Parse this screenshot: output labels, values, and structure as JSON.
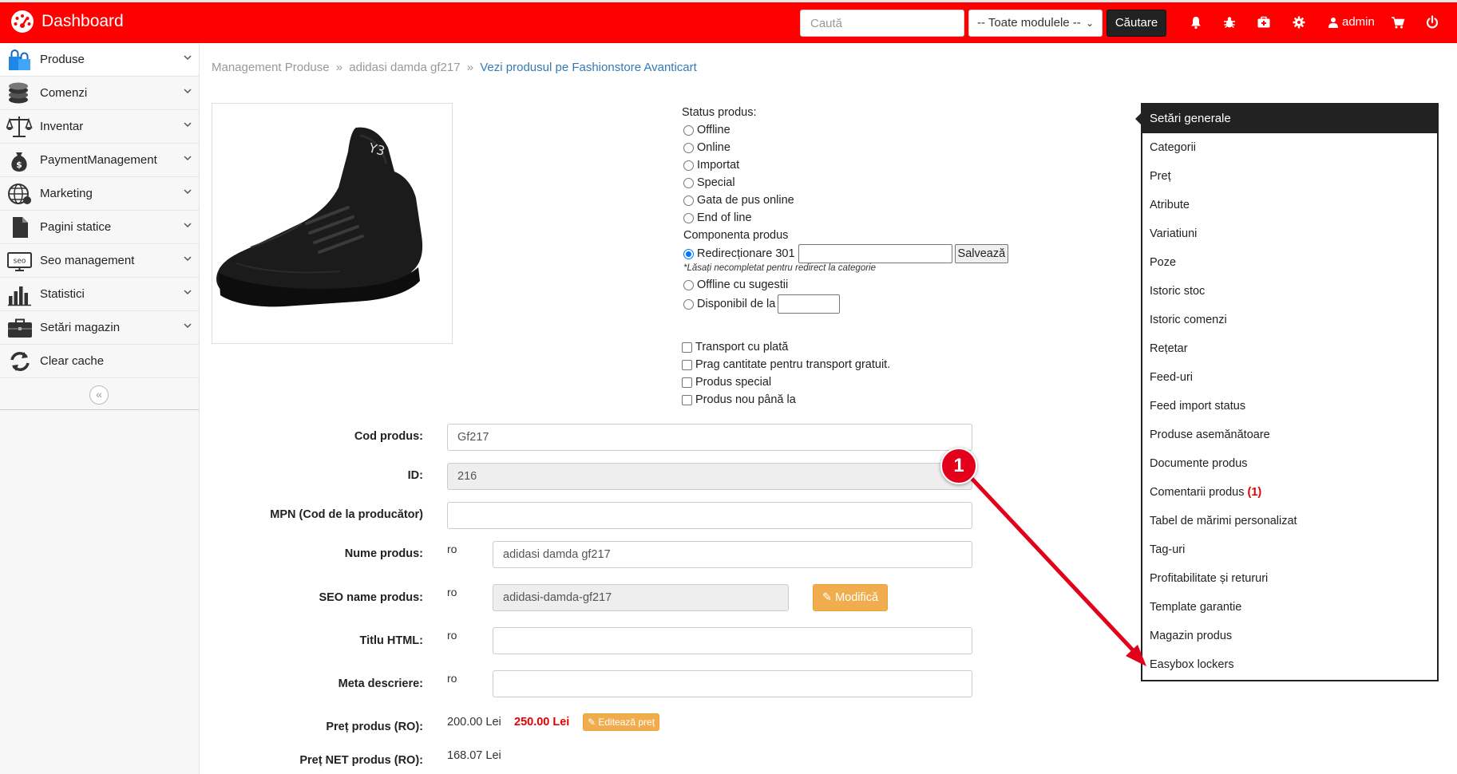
{
  "header": {
    "brand": "Dashboard",
    "search_placeholder": "Caută",
    "module_select": "-- Toate modulele --",
    "search_button": "Căutare",
    "user": "admin",
    "accent": "#ff0000"
  },
  "sidebar": {
    "items": [
      {
        "label": "Produse",
        "icon": "shopping-bags-icon"
      },
      {
        "label": "Comenzi",
        "icon": "coins-icon"
      },
      {
        "label": "Inventar",
        "icon": "scales-icon"
      },
      {
        "label": "PaymentManagement",
        "icon": "money-bag-icon"
      },
      {
        "label": "Marketing",
        "icon": "globe-icon"
      },
      {
        "label": "Pagini statice",
        "icon": "document-icon"
      },
      {
        "label": "Seo management",
        "icon": "seo-icon"
      },
      {
        "label": "Statistici",
        "icon": "bar-chart-icon"
      },
      {
        "label": "Setări magazin",
        "icon": "briefcase-icon"
      },
      {
        "label": "Clear cache",
        "icon": "refresh-icon"
      }
    ],
    "collapse_glyph": "«"
  },
  "breadcrumb": {
    "part1": "Management Produse",
    "sep": "»",
    "part2": "adidasi damda gf217",
    "link": "Vezi produsul pe Fashionstore Avanticart"
  },
  "status": {
    "title": "Status produs:",
    "options": [
      "Offline",
      "Online",
      "Importat",
      "Special",
      "Gata de pus online",
      "End of line"
    ],
    "component_title": "Componenta produs",
    "redirect_label": "Redirecționare 301",
    "save_label": "Salvează",
    "hint": "*Lăsați necompletat pentru redirect la categorie",
    "offline_suggestions": "Offline cu sugestii",
    "available_from": "Disponibil de la"
  },
  "checkboxes": [
    "Transport cu plată",
    "Prag cantitate pentru transport gratuit.",
    "Produs special",
    "Produs nou până la"
  ],
  "form": {
    "code_label": "Cod produs:",
    "code_value": "Gf217",
    "id_label": "ID:",
    "id_value": "216",
    "mpn_label": "MPN (Cod de la producător)",
    "name_label": "Nume produs:",
    "name_value": "adidasi damda gf217",
    "seo_label": "SEO name produs:",
    "seo_value": "adidasi-damda-gf217",
    "modify_button": "Modifică",
    "html_title_label": "Titlu HTML:",
    "meta_label": "Meta descriere:",
    "lang": "ro",
    "price_label": "Preț produs (RO):",
    "price_old": "200.00 Lei",
    "price_new": "250.00 Lei",
    "edit_price_button": "Editează preț",
    "net_price_label": "Preț NET produs (RO):",
    "net_price_value": "168.07 Lei"
  },
  "settings_menu": {
    "title": "Setări generale",
    "items": [
      "Categorii",
      "Preț",
      "Atribute",
      "Variatiuni",
      "Poze",
      "Istoric stoc",
      "Istoric comenzi",
      "Rețetar",
      "Feed-uri",
      "Feed import status",
      "Produse asemănătoare",
      "Documente produs",
      "Comentarii produs",
      "Tabel de mărimi personalizat",
      "Tag-uri",
      "Profitabilitate și retururi",
      "Template garantie",
      "Magazin produs",
      "Easybox lockers"
    ],
    "comments_badge": "(1)"
  },
  "annotation": {
    "number": "1",
    "color": "#e3001b"
  }
}
